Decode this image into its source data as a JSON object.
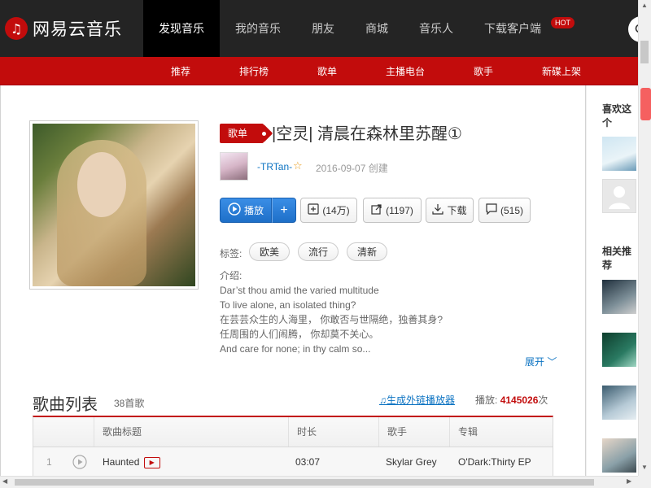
{
  "brand": {
    "logo_text": "网易云音乐",
    "color": "#c20c0c"
  },
  "topnav": {
    "items": [
      "发现音乐",
      "我的音乐",
      "朋友",
      "商城",
      "音乐人",
      "下载客户端"
    ],
    "active": "发现音乐",
    "hot_badge": "HOT",
    "search_icon": "search-icon"
  },
  "subnav": {
    "items": [
      "推荐",
      "排行榜",
      "歌单",
      "主播电台",
      "歌手",
      "新碟上架"
    ]
  },
  "playlist": {
    "badge": "歌单",
    "title": "|空灵| 清晨在森林里苏醒①",
    "creator": "-TRTan-",
    "created": "2016-09-07 创建",
    "buttons": {
      "play": "播放",
      "add": "+",
      "collect": "(14万)",
      "share": "(1197)",
      "download": "下载",
      "comment": "(515)"
    },
    "tags_label": "标签:",
    "tags": [
      "欧美",
      "流行",
      "清新"
    ],
    "intro_label": "介绍:",
    "intro_lines": [
      "Dar’st thou amid the varied multitude",
      "To live alone, an isolated thing?",
      "在芸芸众生的人海里， 你敢否与世隔绝，独善其身?",
      "任周围的人们闹腾， 你却莫不关心。",
      "And care for none; in thy calm so..."
    ],
    "expand": "展开"
  },
  "songlist": {
    "title": "歌曲列表",
    "count": "38首歌",
    "ext_link": "生成外链播放器",
    "plays_label": "播放:",
    "plays_value": "4145026",
    "plays_unit": "次",
    "headers": [
      "歌曲标题",
      "时长",
      "歌手",
      "专辑"
    ],
    "rows": [
      {
        "index": "1",
        "title": "Haunted",
        "duration": "03:07",
        "artist": "Skylar Grey",
        "album": "O'Dark:Thirty EP"
      }
    ]
  },
  "sidebar": {
    "likes_title": "喜欢这个",
    "related_title": "相关推荐"
  }
}
